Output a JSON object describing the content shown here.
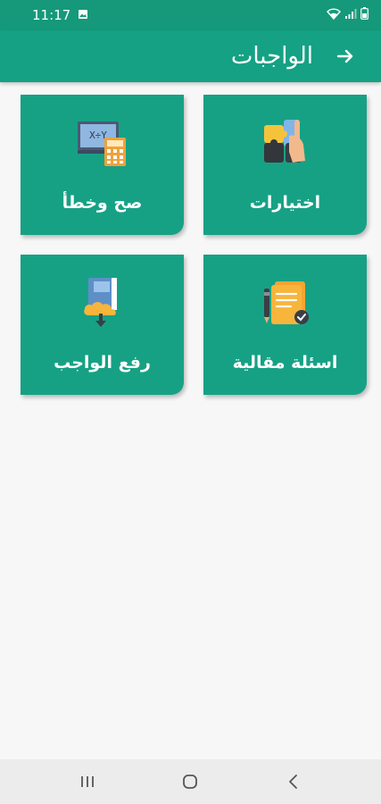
{
  "status_bar": {
    "time": "11:17",
    "icons": [
      "image-icon",
      "wifi-icon",
      "signal-icon",
      "battery-icon"
    ]
  },
  "app_bar": {
    "title": "الواجبات",
    "back_icon": "arrow-right-icon"
  },
  "cards": [
    {
      "label": "اختيارات",
      "icon": "puzzle-hand-icon"
    },
    {
      "label": "صح وخطأ",
      "icon": "calculator-board-icon"
    },
    {
      "label": "اسئلة مقالية",
      "icon": "document-pen-icon"
    },
    {
      "label": "رفع الواجب",
      "icon": "book-upload-icon"
    }
  ],
  "nav_bar": {
    "buttons": [
      "recents-icon",
      "home-icon",
      "back-icon"
    ]
  },
  "colors": {
    "primary": "#15a184",
    "status_bar": "#15997a",
    "card": "#16a185",
    "background": "#f7f7f7"
  }
}
